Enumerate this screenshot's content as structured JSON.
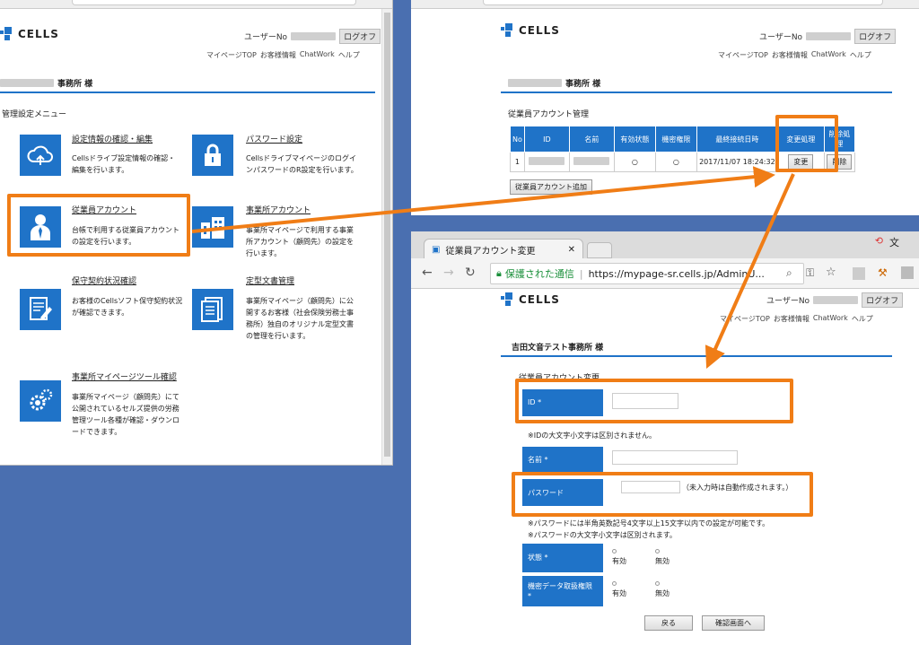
{
  "common": {
    "logo_text": "CELLS",
    "user_label": "ユーザーNo",
    "logoff_label": "ログオフ",
    "nav": [
      "マイページTOP",
      "お客様情報",
      "ChatWork",
      "ヘルプ"
    ],
    "office_suffix": "事務所 様"
  },
  "win1": {
    "menu_heading": "管理設定メニュー",
    "items": [
      {
        "title": "設定情報の確認・編集",
        "desc": "Cellsドライブ設定情報の確認・編集を行います。",
        "icon": "cloud-upload-icon"
      },
      {
        "title": "パスワード設定",
        "desc": "CellsドライブマイページのログインパスワードのR設定を行います。",
        "icon": "lock-icon"
      },
      {
        "title": "従業員アカウント",
        "desc": "台帳で利用する従業員アカウントの設定を行います。",
        "icon": "person-icon"
      },
      {
        "title": "事業所アカウント",
        "desc": "事業所マイページで利用する事業所アカウント（顧問先）の設定を行います。",
        "icon": "building-icon"
      },
      {
        "title": "保守契約状況確認",
        "desc": "お客様のCellsソフト保守契約状況が確認できます。",
        "icon": "document-icon"
      },
      {
        "title": "定型文書管理",
        "desc": "事業所マイページ（顧問先）に公開するお客様（社会保険労務士事務所）独自のオリジナル定型文書の管理を行います。",
        "icon": "template-icon"
      },
      {
        "title": "事業所マイページツール確認",
        "desc": "事業所マイページ（顧問先）にて公開されているセルズ提供の労務管理ツール各種が確認・ダウンロードできます。",
        "icon": "gears-icon"
      }
    ]
  },
  "win2": {
    "section_title": "従業員アカウント管理",
    "columns": [
      "No",
      "ID",
      "名前",
      "有効状態",
      "機密権限",
      "最終接続日時",
      "変更処理",
      "削除処理"
    ],
    "row": {
      "no": "1",
      "valid": "○",
      "secret": "○",
      "last_login": "2017/11/07 18:24:32",
      "edit_btn": "変更",
      "delete_btn": "削除"
    },
    "add_button": "従業員アカウント追加"
  },
  "win3": {
    "tab_title": "従業員アカウント変更",
    "secure_label": "保護された通信",
    "url": "https://mypage-sr.cells.jp/AdminU...",
    "office_name": "吉田文音テスト事務所 様",
    "form_title": "従業員アカウント変更",
    "id_label": "ID *",
    "id_note": "※IDの大文字小文字は区別されません。",
    "name_label": "名前 *",
    "password_label": "パスワード",
    "password_hint": "（未入力時は自動作成されます。）",
    "password_note1": "※パスワードには半角英数記号4文字以上15文字以内での設定が可能です。",
    "password_note2": "※パスワードの大文字小文字は区別されます。",
    "status_label": "状態 *",
    "secret_label": "機密データ取扱権限 *",
    "opt_valid": "有効",
    "opt_invalid": "無効",
    "back_button": "戻る",
    "confirm_button": "確認画面へ"
  }
}
